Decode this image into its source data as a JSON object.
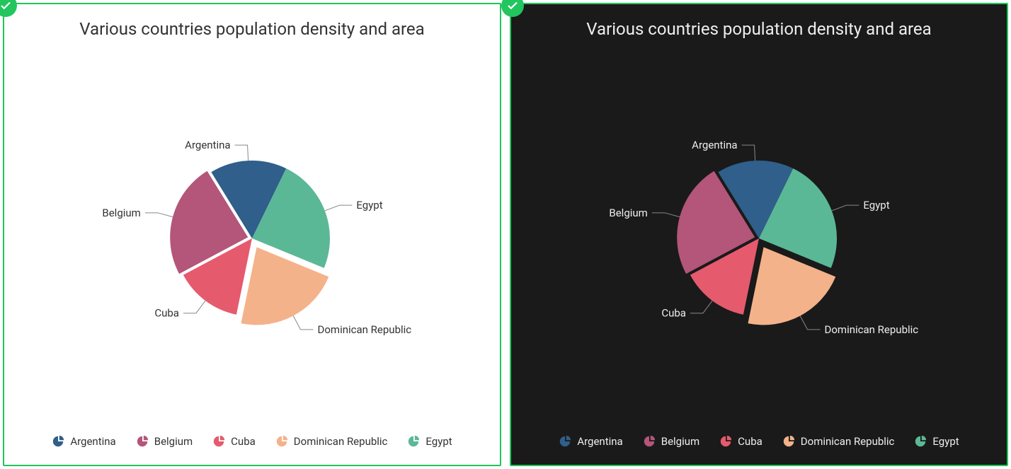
{
  "chart_data": {
    "type": "pie",
    "title": "Various countries population density and area",
    "series": [
      {
        "name": "Argentina",
        "value": 16,
        "color": "#2f5f8a",
        "offset": 0
      },
      {
        "name": "Belgium",
        "value": 24,
        "color": "#b4557a",
        "offset": 6
      },
      {
        "name": "Cuba",
        "value": 14,
        "color": "#e65a6d",
        "offset": 0
      },
      {
        "name": "Dominican Republic",
        "value": 22,
        "color": "#f4b28a",
        "offset": 14
      },
      {
        "name": "Egypt",
        "value": 24,
        "color": "#5bb896",
        "offset": 0
      }
    ],
    "start_angle": 64
  },
  "panels": [
    {
      "theme": "light"
    },
    {
      "theme": "dark"
    }
  ]
}
